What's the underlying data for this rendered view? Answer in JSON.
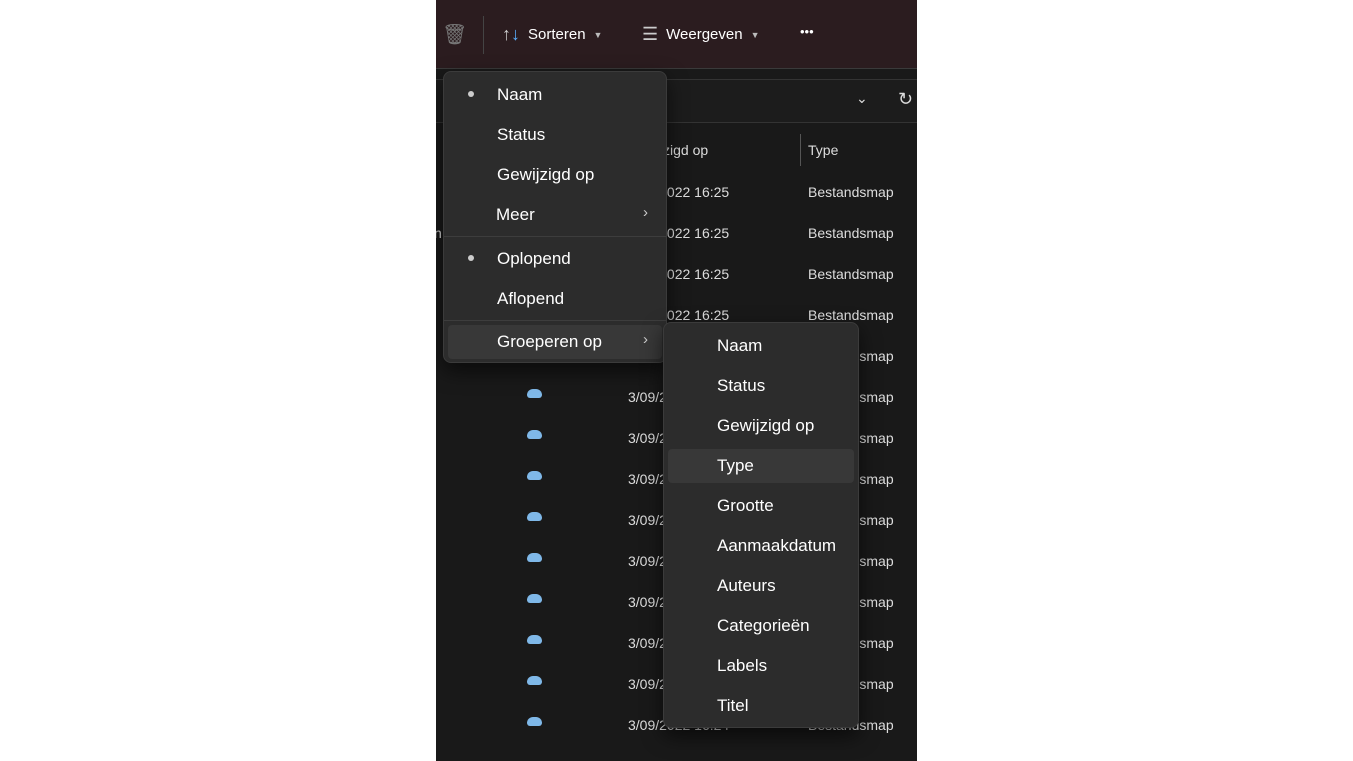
{
  "toolbar": {
    "sort": "Sorteren",
    "view": "Weergeven",
    "more": "•••"
  },
  "columns": {
    "modified": "Gewijzigd op",
    "type": "Type"
  },
  "rows": [
    {
      "name": "",
      "date": "3/09/2022 16:25",
      "type": "Bestandsmap",
      "cloud": false
    },
    {
      "name": "n",
      "date": "3/09/2022 16:25",
      "type": "Bestandsmap",
      "cloud": false
    },
    {
      "name": "",
      "date": "3/09/2022 16:25",
      "type": "Bestandsmap",
      "cloud": false
    },
    {
      "name": "",
      "date": "3/09/2022 16:25",
      "type": "Bestandsmap",
      "cloud": false
    },
    {
      "name": "",
      "date": "3/09/2022 16:24",
      "type": "Bestandsmap",
      "cloud": false
    },
    {
      "name": "",
      "date": "3/09/2022 16:24",
      "type": "Bestandsmap",
      "cloud": true
    },
    {
      "name": "",
      "date": "3/09/2022 16:24",
      "type": "Bestandsmap",
      "cloud": true
    },
    {
      "name": "",
      "date": "3/09/2022 16:24",
      "type": "Bestandsmap",
      "cloud": true
    },
    {
      "name": "",
      "date": "3/09/2022 16:24",
      "type": "Bestandsmap",
      "cloud": true
    },
    {
      "name": "",
      "date": "3/09/2022 16:24",
      "type": "Bestandsmap",
      "cloud": true
    },
    {
      "name": "",
      "date": "3/09/2022 16:24",
      "type": "Bestandsmap",
      "cloud": true
    },
    {
      "name": "",
      "date": "3/09/2022 16:24",
      "type": "Bestandsmap",
      "cloud": true
    },
    {
      "name": "",
      "date": "3/09/2022 16:24",
      "type": "Bestandsmap",
      "cloud": true
    },
    {
      "name": "",
      "date": "3/09/2022 16:24",
      "type": "Bestandsmap",
      "cloud": true
    }
  ],
  "sort_menu": {
    "items": [
      "Naam",
      "Status",
      "Gewijzigd op",
      "Meer"
    ],
    "order": [
      "Oplopend",
      "Aflopend"
    ],
    "group": "Groeperen op"
  },
  "group_menu": {
    "items": [
      "Naam",
      "Status",
      "Gewijzigd op",
      "Type",
      "Grootte",
      "Aanmaakdatum",
      "Auteurs",
      "Categorieën",
      "Labels",
      "Titel"
    ],
    "selected": "Type"
  }
}
